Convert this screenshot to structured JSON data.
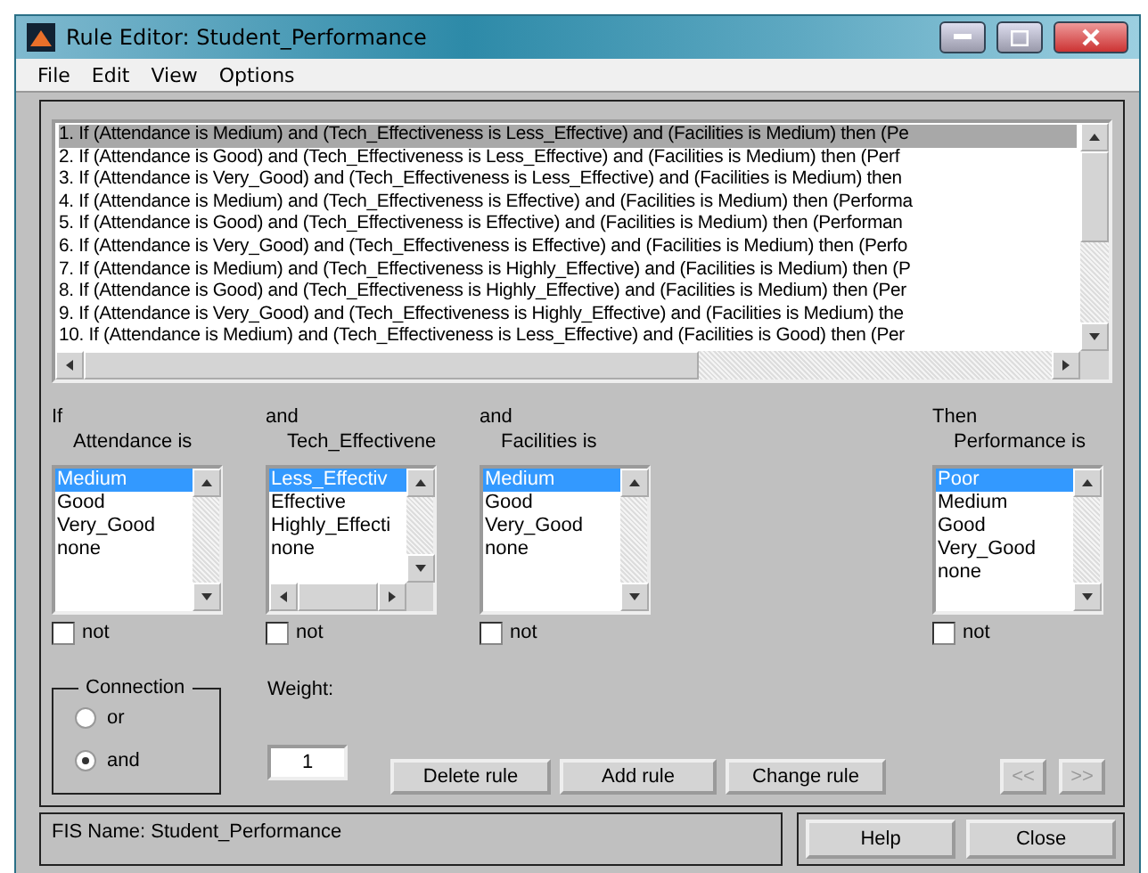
{
  "window": {
    "title": "Rule Editor: Student_Performance"
  },
  "menu": [
    "File",
    "Edit",
    "View",
    "Options"
  ],
  "rules": [
    {
      "text": "1. If (Attendance is Medium) and (Tech_Effectiveness is Less_Effective) and (Facilities is Medium) then (Pe",
      "selected": true
    },
    {
      "text": "2. If (Attendance is Good) and (Tech_Effectiveness is Less_Effective) and (Facilities is Medium) then (Perf",
      "selected": false
    },
    {
      "text": "3. If (Attendance is Very_Good) and (Tech_Effectiveness is Less_Effective) and (Facilities is Medium) then",
      "selected": false
    },
    {
      "text": "4. If (Attendance is Medium) and (Tech_Effectiveness is Effective) and (Facilities is Medium) then (Performa",
      "selected": false
    },
    {
      "text": "5. If (Attendance is Good) and (Tech_Effectiveness is Effective) and (Facilities is Medium) then (Performan",
      "selected": false
    },
    {
      "text": "6. If (Attendance is Very_Good) and (Tech_Effectiveness is Effective) and (Facilities is Medium) then (Perfo",
      "selected": false
    },
    {
      "text": "7. If (Attendance is Medium) and (Tech_Effectiveness is Highly_Effective) and (Facilities is Medium) then (P",
      "selected": false
    },
    {
      "text": "8. If (Attendance is Good) and (Tech_Effectiveness is Highly_Effective) and (Facilities is Medium) then (Per",
      "selected": false
    },
    {
      "text": "9. If (Attendance is Very_Good) and (Tech_Effectiveness is Highly_Effective) and (Facilities is Medium) the",
      "selected": false
    },
    {
      "text": "10. If (Attendance is Medium) and (Tech_Effectiveness is Less_Effective) and (Facilities is Good) then (Per",
      "selected": false
    }
  ],
  "columns": [
    {
      "connector": "If",
      "label": "Attendance is",
      "horizontal_scroll": false,
      "not_label": "not",
      "not_checked": false,
      "options": [
        {
          "label": "Medium",
          "selected": true
        },
        {
          "label": "Good",
          "selected": false
        },
        {
          "label": "Very_Good",
          "selected": false
        },
        {
          "label": "none",
          "selected": false
        }
      ]
    },
    {
      "connector": "and",
      "label": "Tech_Effectivene",
      "horizontal_scroll": true,
      "not_label": "not",
      "not_checked": false,
      "options": [
        {
          "label": "Less_Effectiv",
          "selected": true
        },
        {
          "label": "Effective",
          "selected": false
        },
        {
          "label": "Highly_Effecti",
          "selected": false
        },
        {
          "label": "none",
          "selected": false
        }
      ]
    },
    {
      "connector": "and",
      "label": "Facilities is",
      "horizontal_scroll": false,
      "not_label": "not",
      "not_checked": false,
      "options": [
        {
          "label": "Medium",
          "selected": true
        },
        {
          "label": "Good",
          "selected": false
        },
        {
          "label": "Very_Good",
          "selected": false
        },
        {
          "label": "none",
          "selected": false
        }
      ]
    },
    {
      "connector": "Then",
      "label": "Performance is",
      "horizontal_scroll": false,
      "not_label": "not",
      "not_checked": false,
      "options": [
        {
          "label": "Poor",
          "selected": true
        },
        {
          "label": "Medium",
          "selected": false
        },
        {
          "label": "Good",
          "selected": false
        },
        {
          "label": "Very_Good",
          "selected": false
        },
        {
          "label": "none",
          "selected": false
        }
      ]
    }
  ],
  "connection": {
    "title": "Connection",
    "options": [
      {
        "label": "or",
        "selected": false
      },
      {
        "label": "and",
        "selected": true
      }
    ]
  },
  "weight": {
    "label": "Weight:",
    "value": "1"
  },
  "buttons": [
    {
      "label": "Delete rule",
      "disabled": false
    },
    {
      "label": "Add rule",
      "disabled": false
    },
    {
      "label": "Change rule",
      "disabled": false
    }
  ],
  "nav_buttons": [
    {
      "label": "<<",
      "disabled": true
    },
    {
      "label": ">>",
      "disabled": true
    }
  ],
  "status": "FIS Name: Student_Performance",
  "footer_buttons": [
    "Help",
    "Close"
  ]
}
